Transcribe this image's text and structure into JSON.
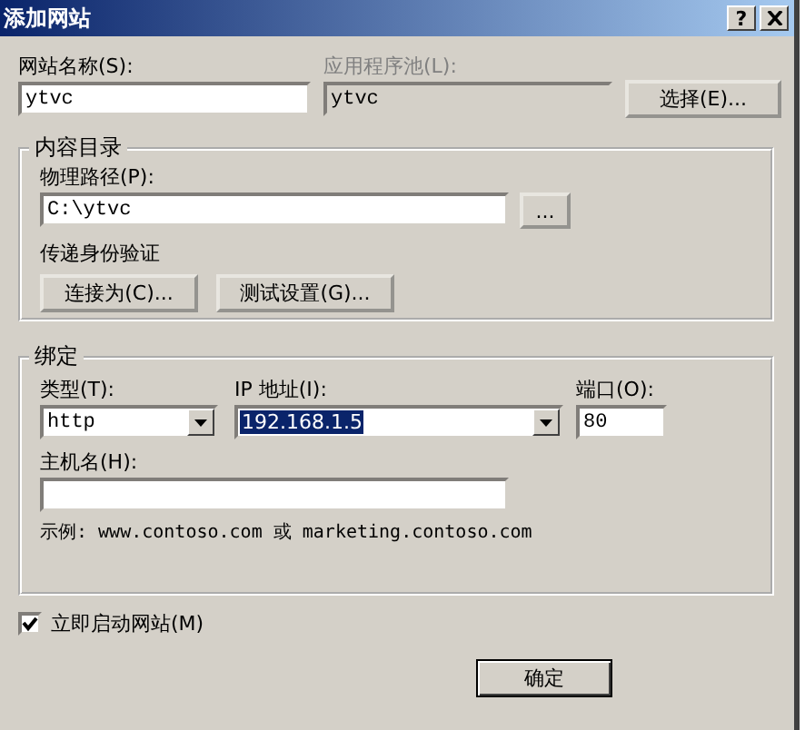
{
  "window": {
    "title": "添加网站",
    "help_button": "?"
  },
  "site_name": {
    "label": "网站名称(S):",
    "value": "ytvc"
  },
  "app_pool": {
    "label": "应用程序池(L):",
    "value": "ytvc",
    "disabled": true
  },
  "select_button": "选择(E)...",
  "content_directory": {
    "title": "内容目录",
    "path_label": "物理路径(P):",
    "path_value": "C:\\ytvc",
    "browse_button": "...",
    "auth_label": "传递身份验证",
    "buttons": [
      "连接为(C)...",
      "测试设置(G)..."
    ]
  },
  "binding": {
    "title": "绑定",
    "type": {
      "label": "类型(T):",
      "value": "http"
    },
    "ip": {
      "label": "IP 地址(I):",
      "value": "192.168.1.5",
      "selected": true
    },
    "port": {
      "label": "端口(O):",
      "value": "80"
    },
    "host": {
      "label": "主机名(H):"
    },
    "example": "示例: www.contoso.com 或 marketing.contoso.com"
  },
  "start_site": {
    "label": "立即启动网站(M)",
    "checked": true
  },
  "ok_button": "确定"
}
